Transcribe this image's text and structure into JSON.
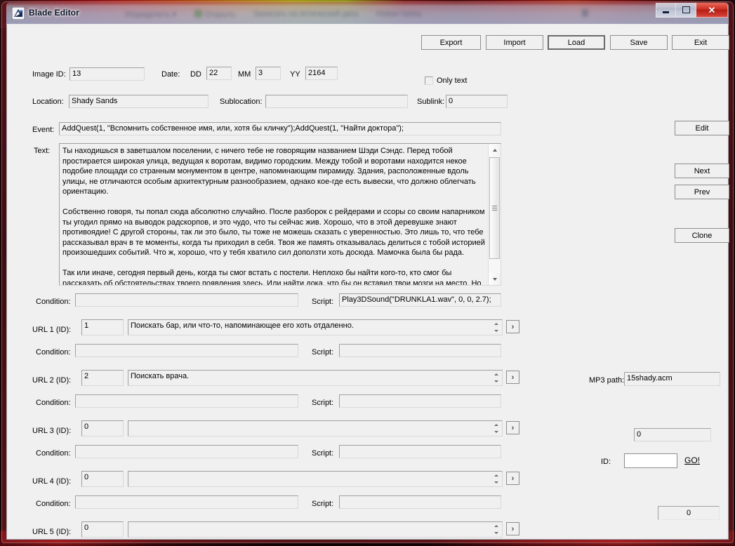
{
  "window": {
    "title": "Blade Editor",
    "icon": "blade-editor-app-icon",
    "controls": {
      "minimize": "minimize-icon",
      "maximize": "maximize-icon",
      "close": "close-icon"
    }
  },
  "toolbar": {
    "export_label": "Export",
    "import_label": "Import",
    "load_label": "Load",
    "save_label": "Save",
    "exit_label": "Exit",
    "only_text_label": "Only text",
    "only_text_checked": false
  },
  "header": {
    "image_id_label": "Image ID:",
    "image_id_value": "13",
    "date_label": "Date:",
    "dd_label": "DD",
    "dd_value": "22",
    "mm_label": "MM",
    "mm_value": "3",
    "yy_label": "YY",
    "yy_value": "2164",
    "location_label": "Location:",
    "location_value": "Shady Sands",
    "sublocation_label": "Sublocation:",
    "sublocation_value": "",
    "sublink_label": "Sublink:",
    "sublink_value": "0"
  },
  "event": {
    "label": "Event:",
    "value": "AddQuest(1, \"Вспомнить собственное имя, или, хотя бы кличку\");AddQuest(1, \"Найти доктора\");"
  },
  "text": {
    "label": "Text:",
    "paragraphs": [
      "Ты находишься в заветшалом поселении, с ничего тебе не говорящим названием Шэди Сэндс. Перед тобой простирается широкая улица, ведущая к воротам, видимо городским. Между тобой и воротами находится некое подобие площади со странным монументом в центре, напоминающим пирамиду. Здания, расположенные вдоль улицы, не отличаются особым архитектурным разнообразием, однако кое-где есть вывески, что должно облегчать ориентацию.",
      "Собственно говоря, ты попал сюда абсолютно случайно. После разборок с рейдерами и ссоры со своим напарником ты угодил прямо на выводок радскорпов, и это чудо, что ты сейчас жив. Хорошо, что в этой деревушке знают противоядие! С другой стороны, так ли это было, ты тоже не можешь сказать с уверенностью. Это лишь то, что тебе рассказывал врач в те моменты, когда ты приходил в себя. Твоя же память отказывалась делиться с тобой историей произошедших событий. Что ж, хорошо, что у тебя хватило сил доползти хоть досюда. Мамочка была бы рада.",
      "Так или иначе, сегодня первый день, когда ты смог встать с постели. Неплохо бы найти кого-то, кто смог бы рассказать об обстоятельствах твоего появления здесь. Или найти дока, что бы он вставил твои мозги на место. Но первым делом надо вспомнить собственное имя.."
    ]
  },
  "side_buttons": {
    "edit_label": "Edit",
    "next_label": "Next",
    "prev_label": "Prev",
    "clone_label": "Clone"
  },
  "labels": {
    "condition": "Condition:",
    "script": "Script:",
    "expand_arrow": "›"
  },
  "top_condition": {
    "condition_value": "",
    "script_value": "Play3DSound(\"DRUNKLA1.wav\", 0, 0, 2.7);"
  },
  "urls": [
    {
      "label": "URL 1 (ID):",
      "id_value": "1",
      "text_value": "Поискать бар, или что-то, напоминающее его хоть отдаленно.",
      "condition_value": "",
      "script_value": ""
    },
    {
      "label": "URL 2 (ID):",
      "id_value": "2",
      "text_value": "Поискать врача.",
      "condition_value": "",
      "script_value": ""
    },
    {
      "label": "URL 3 (ID):",
      "id_value": "0",
      "text_value": "",
      "condition_value": "",
      "script_value": ""
    },
    {
      "label": "URL 4 (ID):",
      "id_value": "0",
      "text_value": "",
      "condition_value": "",
      "script_value": ""
    },
    {
      "label": "URL 5 (ID):",
      "id_value": "0",
      "text_value": "",
      "condition_value": "",
      "script_value": ""
    }
  ],
  "right_panel": {
    "mp3_path_label": "MP3 path:",
    "mp3_path_value": "15shady.acm",
    "counter_value": "0",
    "id_label": "ID:",
    "id_value": "",
    "go_label": "GO!",
    "status_value": "0"
  },
  "colors": {
    "form_face": "#f0f0f0",
    "frame_red": "#78161e",
    "close_red": "#cf2f22",
    "glass_blue": "#b2c8e2"
  }
}
